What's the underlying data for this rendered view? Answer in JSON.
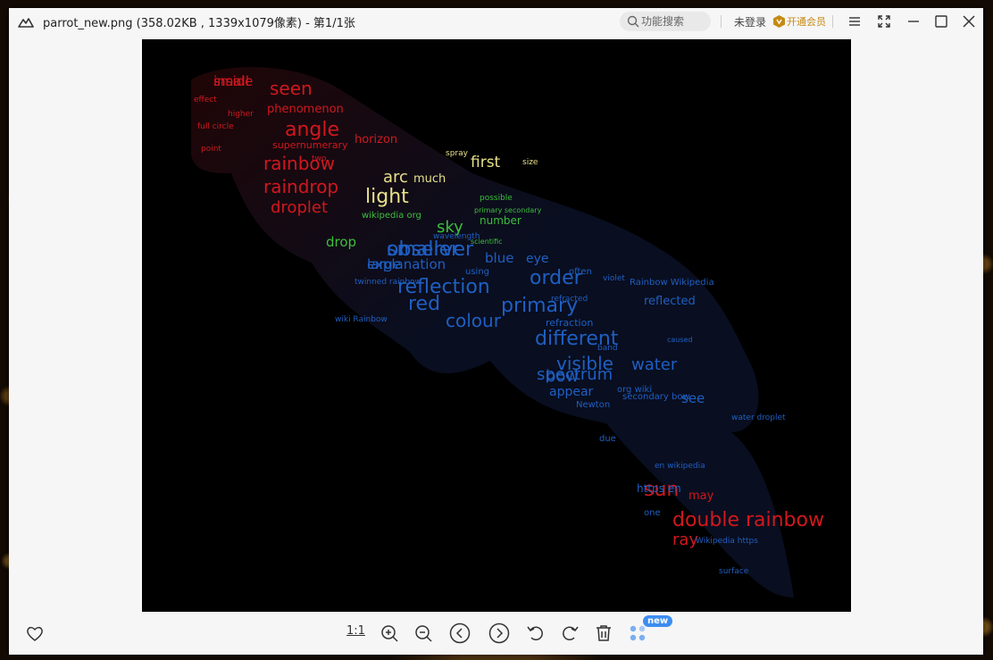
{
  "titlebar": {
    "title": "parrot_new.png (358.02KB , 1339x1079像素) - 第1/1张",
    "search_placeholder": "功能搜索",
    "login_label": "未登录",
    "vip_label": "开通会员"
  },
  "toolbar": {
    "one_to_one_label": "1:1",
    "new_badge": "new"
  },
  "wordcloud": {
    "words_red": [
      "inside",
      "seen",
      "phenomenon",
      "angle",
      "horizon",
      "rainbow",
      "raindrop",
      "droplet",
      "supernumerary",
      "effect",
      "higher",
      "point",
      "double rainbow",
      "sun",
      "ray",
      "may",
      "two",
      "full circle",
      "small"
    ],
    "words_yellow": [
      "arc",
      "light",
      "first",
      "much",
      "spray",
      "size"
    ],
    "words_green": [
      "sky",
      "number",
      "drop",
      "wikipedia org",
      "possible",
      "scientific",
      "primary secondary"
    ],
    "words_blue": [
      "observer",
      "explanation",
      "reflection",
      "order",
      "blue",
      "eye",
      "red",
      "primary",
      "colour",
      "reflected",
      "refraction",
      "different",
      "visible",
      "water",
      "bow",
      "spectrum",
      "appear",
      "see",
      "band",
      "caused",
      "secondary bow",
      "Newton",
      "due",
      "https en",
      "one",
      "water droplet",
      "using",
      "often",
      "Rainbow Wikipedia",
      "violet",
      "wavelength",
      "refracted",
      "twinned rainbow",
      "wiki Rainbow",
      "org wiki",
      "en wikipedia",
      "Wikipedia https",
      "surface",
      "smaller",
      "large"
    ]
  },
  "colors": {
    "window_bg": "#f6f6f6",
    "viewport_bg": "#000000",
    "vip_gold": "#c68a16",
    "badge_blue": "#3d8df0",
    "red_words": "#d0181e",
    "blue_words": "#1f5fc2",
    "green_words": "#3cbf3c",
    "yellow_words": "#e8e08a"
  }
}
